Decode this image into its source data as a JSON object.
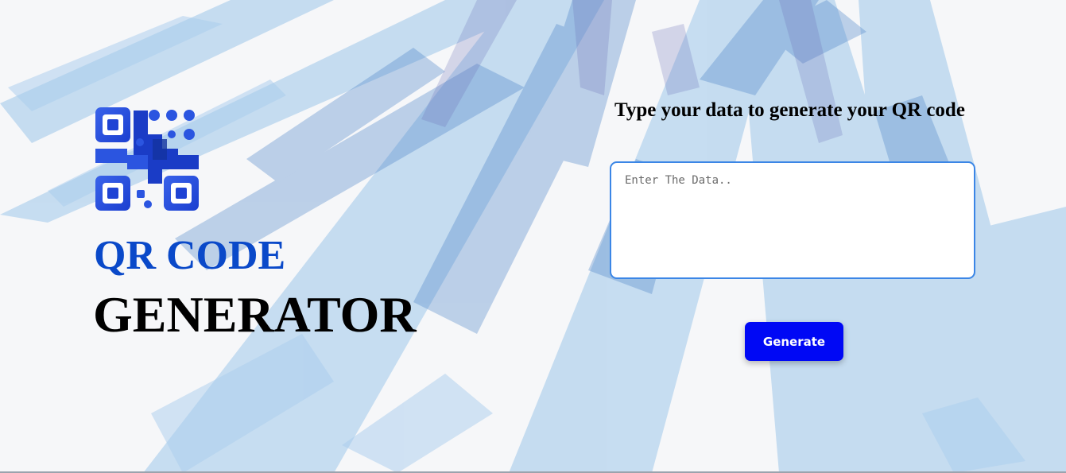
{
  "header": {
    "logo_icon": "qr-code-icon",
    "title_line1": "QR CODE",
    "title_line2": "GENERATOR"
  },
  "form": {
    "prompt": "Type your data to generate your QR code",
    "input_placeholder": "Enter The Data..",
    "input_value": "",
    "generate_label": "Generate"
  },
  "colors": {
    "accent_blue": "#0a49c9",
    "button_blue": "#0008f5",
    "input_border": "#3b86e6",
    "logo_blue": "#2b55e0"
  }
}
